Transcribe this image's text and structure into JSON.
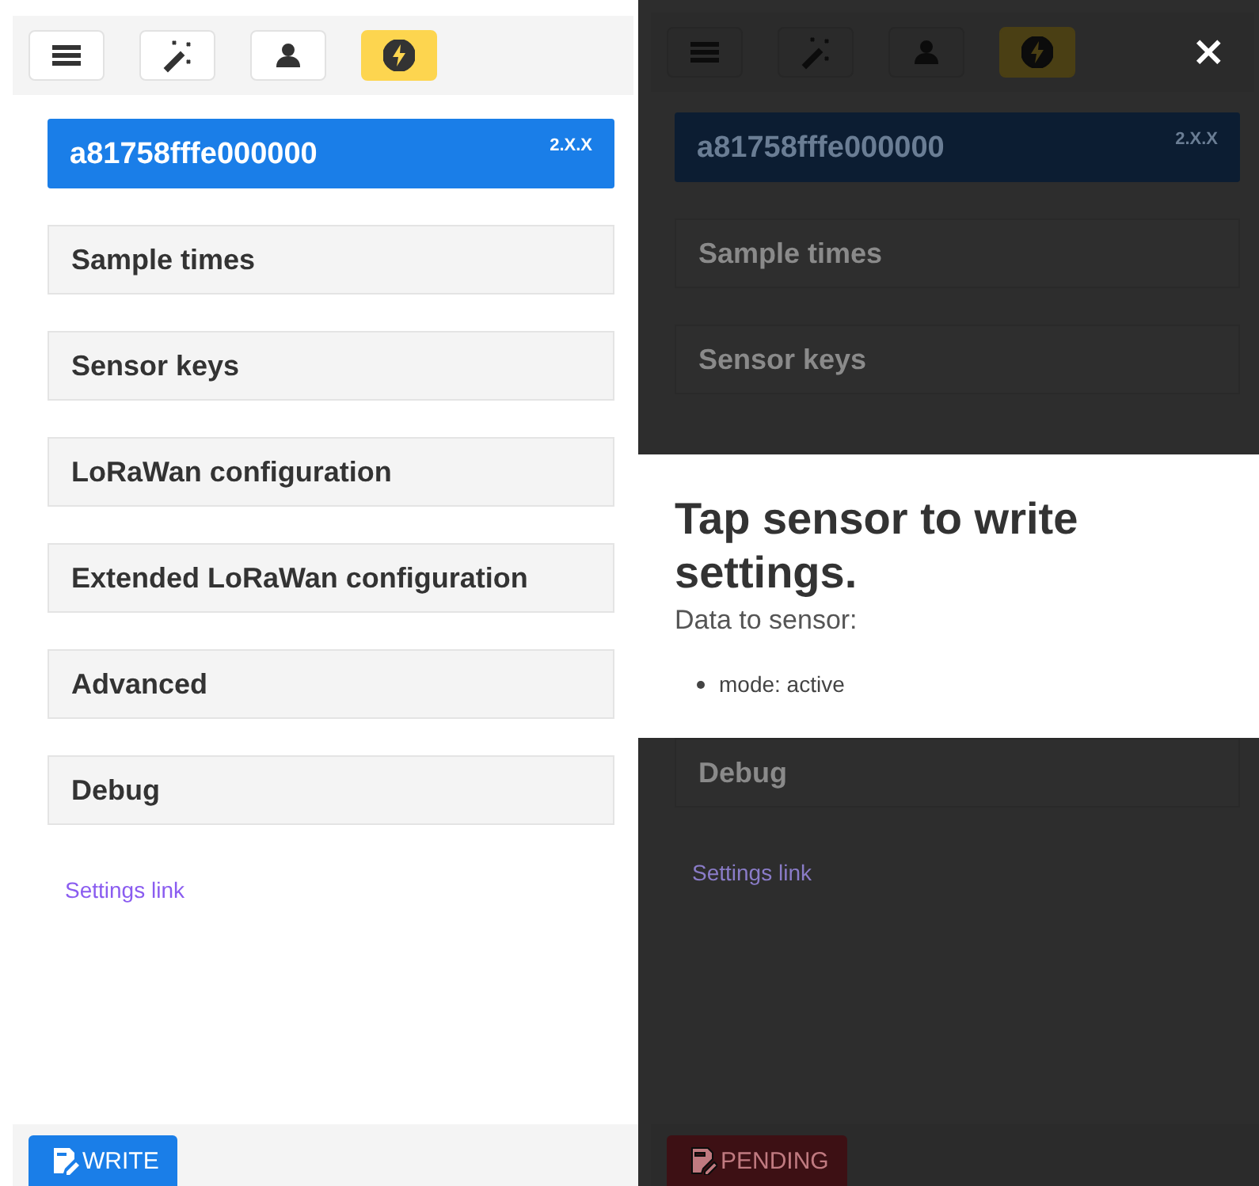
{
  "screens": [
    {
      "dimmed": false,
      "toolbar": [
        {
          "kind": "menu",
          "selected": false
        },
        {
          "kind": "wand",
          "selected": false
        },
        {
          "kind": "person",
          "selected": false
        },
        {
          "kind": "bolt",
          "selected": true
        }
      ],
      "blocks": [
        {
          "kind": "device",
          "id": "a81758fffe000000",
          "version": "2.X.X"
        },
        {
          "kind": "section",
          "label": "Sample times"
        },
        {
          "kind": "section",
          "label": "Sensor keys"
        },
        {
          "kind": "section",
          "label": "LoRaWan configuration"
        },
        {
          "kind": "section",
          "label": "Extended LoRaWan configuration"
        },
        {
          "kind": "section",
          "label": "Advanced"
        },
        {
          "kind": "section",
          "label": "Debug"
        },
        {
          "kind": "link",
          "label": "Settings link"
        }
      ],
      "footer_button": {
        "label": "WRITE",
        "kind": "write"
      }
    },
    {
      "dimmed": true,
      "close": "×",
      "toolbar": [
        {
          "kind": "menu",
          "selected": false
        },
        {
          "kind": "wand",
          "selected": false
        },
        {
          "kind": "person",
          "selected": false
        },
        {
          "kind": "bolt",
          "selected": true
        }
      ],
      "blocks": [
        {
          "kind": "device",
          "id": "a81758fffe000000",
          "version": "2.X.X"
        },
        {
          "kind": "section",
          "label": "Sample times"
        },
        {
          "kind": "section",
          "label": "Sensor keys"
        },
        {
          "kind": "modal",
          "title": "Tap sensor to write settings.",
          "subtitle": "Data to sensor:",
          "items": [
            "mode: active"
          ]
        },
        {
          "kind": "section",
          "label": "Debug"
        },
        {
          "kind": "link",
          "label": "Settings link"
        }
      ],
      "footer_button": {
        "label": "PENDING",
        "kind": "pending"
      }
    }
  ]
}
